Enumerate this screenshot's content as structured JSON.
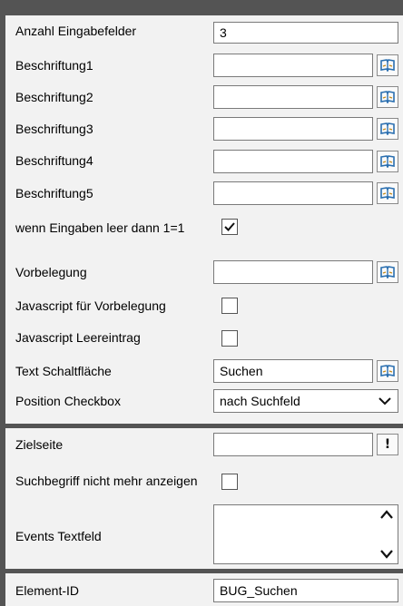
{
  "section1": {
    "rows": [
      {
        "label": "Anzahl Eingabefelder",
        "value": "3"
      },
      {
        "label": "Beschriftung1",
        "value": ""
      },
      {
        "label": "Beschriftung2",
        "value": ""
      },
      {
        "label": "Beschriftung3",
        "value": ""
      },
      {
        "label": "Beschriftung4",
        "value": ""
      },
      {
        "label": "Beschriftung5",
        "value": ""
      },
      {
        "label": "wenn Eingaben leer dann 1=1",
        "checked": true
      },
      {
        "label": "Vorbelegung",
        "value": ""
      },
      {
        "label": "Javascript für Vorbelegung",
        "checked": false
      },
      {
        "label": "Javascript Leereintrag",
        "checked": false
      },
      {
        "label": "Text Schaltfläche",
        "value": "Suchen"
      },
      {
        "label": "Position Checkbox",
        "selected": "nach Suchfeld"
      }
    ]
  },
  "section2": {
    "rows": [
      {
        "label": "Zielseite",
        "value": "",
        "button": "!"
      },
      {
        "label": "Suchbegriff nicht mehr anzeigen",
        "checked": false
      },
      {
        "label": "Events Textfeld",
        "value": ""
      }
    ]
  },
  "section3": {
    "rows": [
      {
        "label": "Element-ID",
        "value": "BUG_Suchen"
      }
    ]
  },
  "icons": {
    "book": "book-icon",
    "check": "checkmark-icon",
    "chevron_down": "chevron-down-icon",
    "chevron_up": "chevron-up-icon"
  },
  "colors": {
    "background": "#545454",
    "panel": "#f2f2f2",
    "book_icon": "#2a6fb0"
  }
}
